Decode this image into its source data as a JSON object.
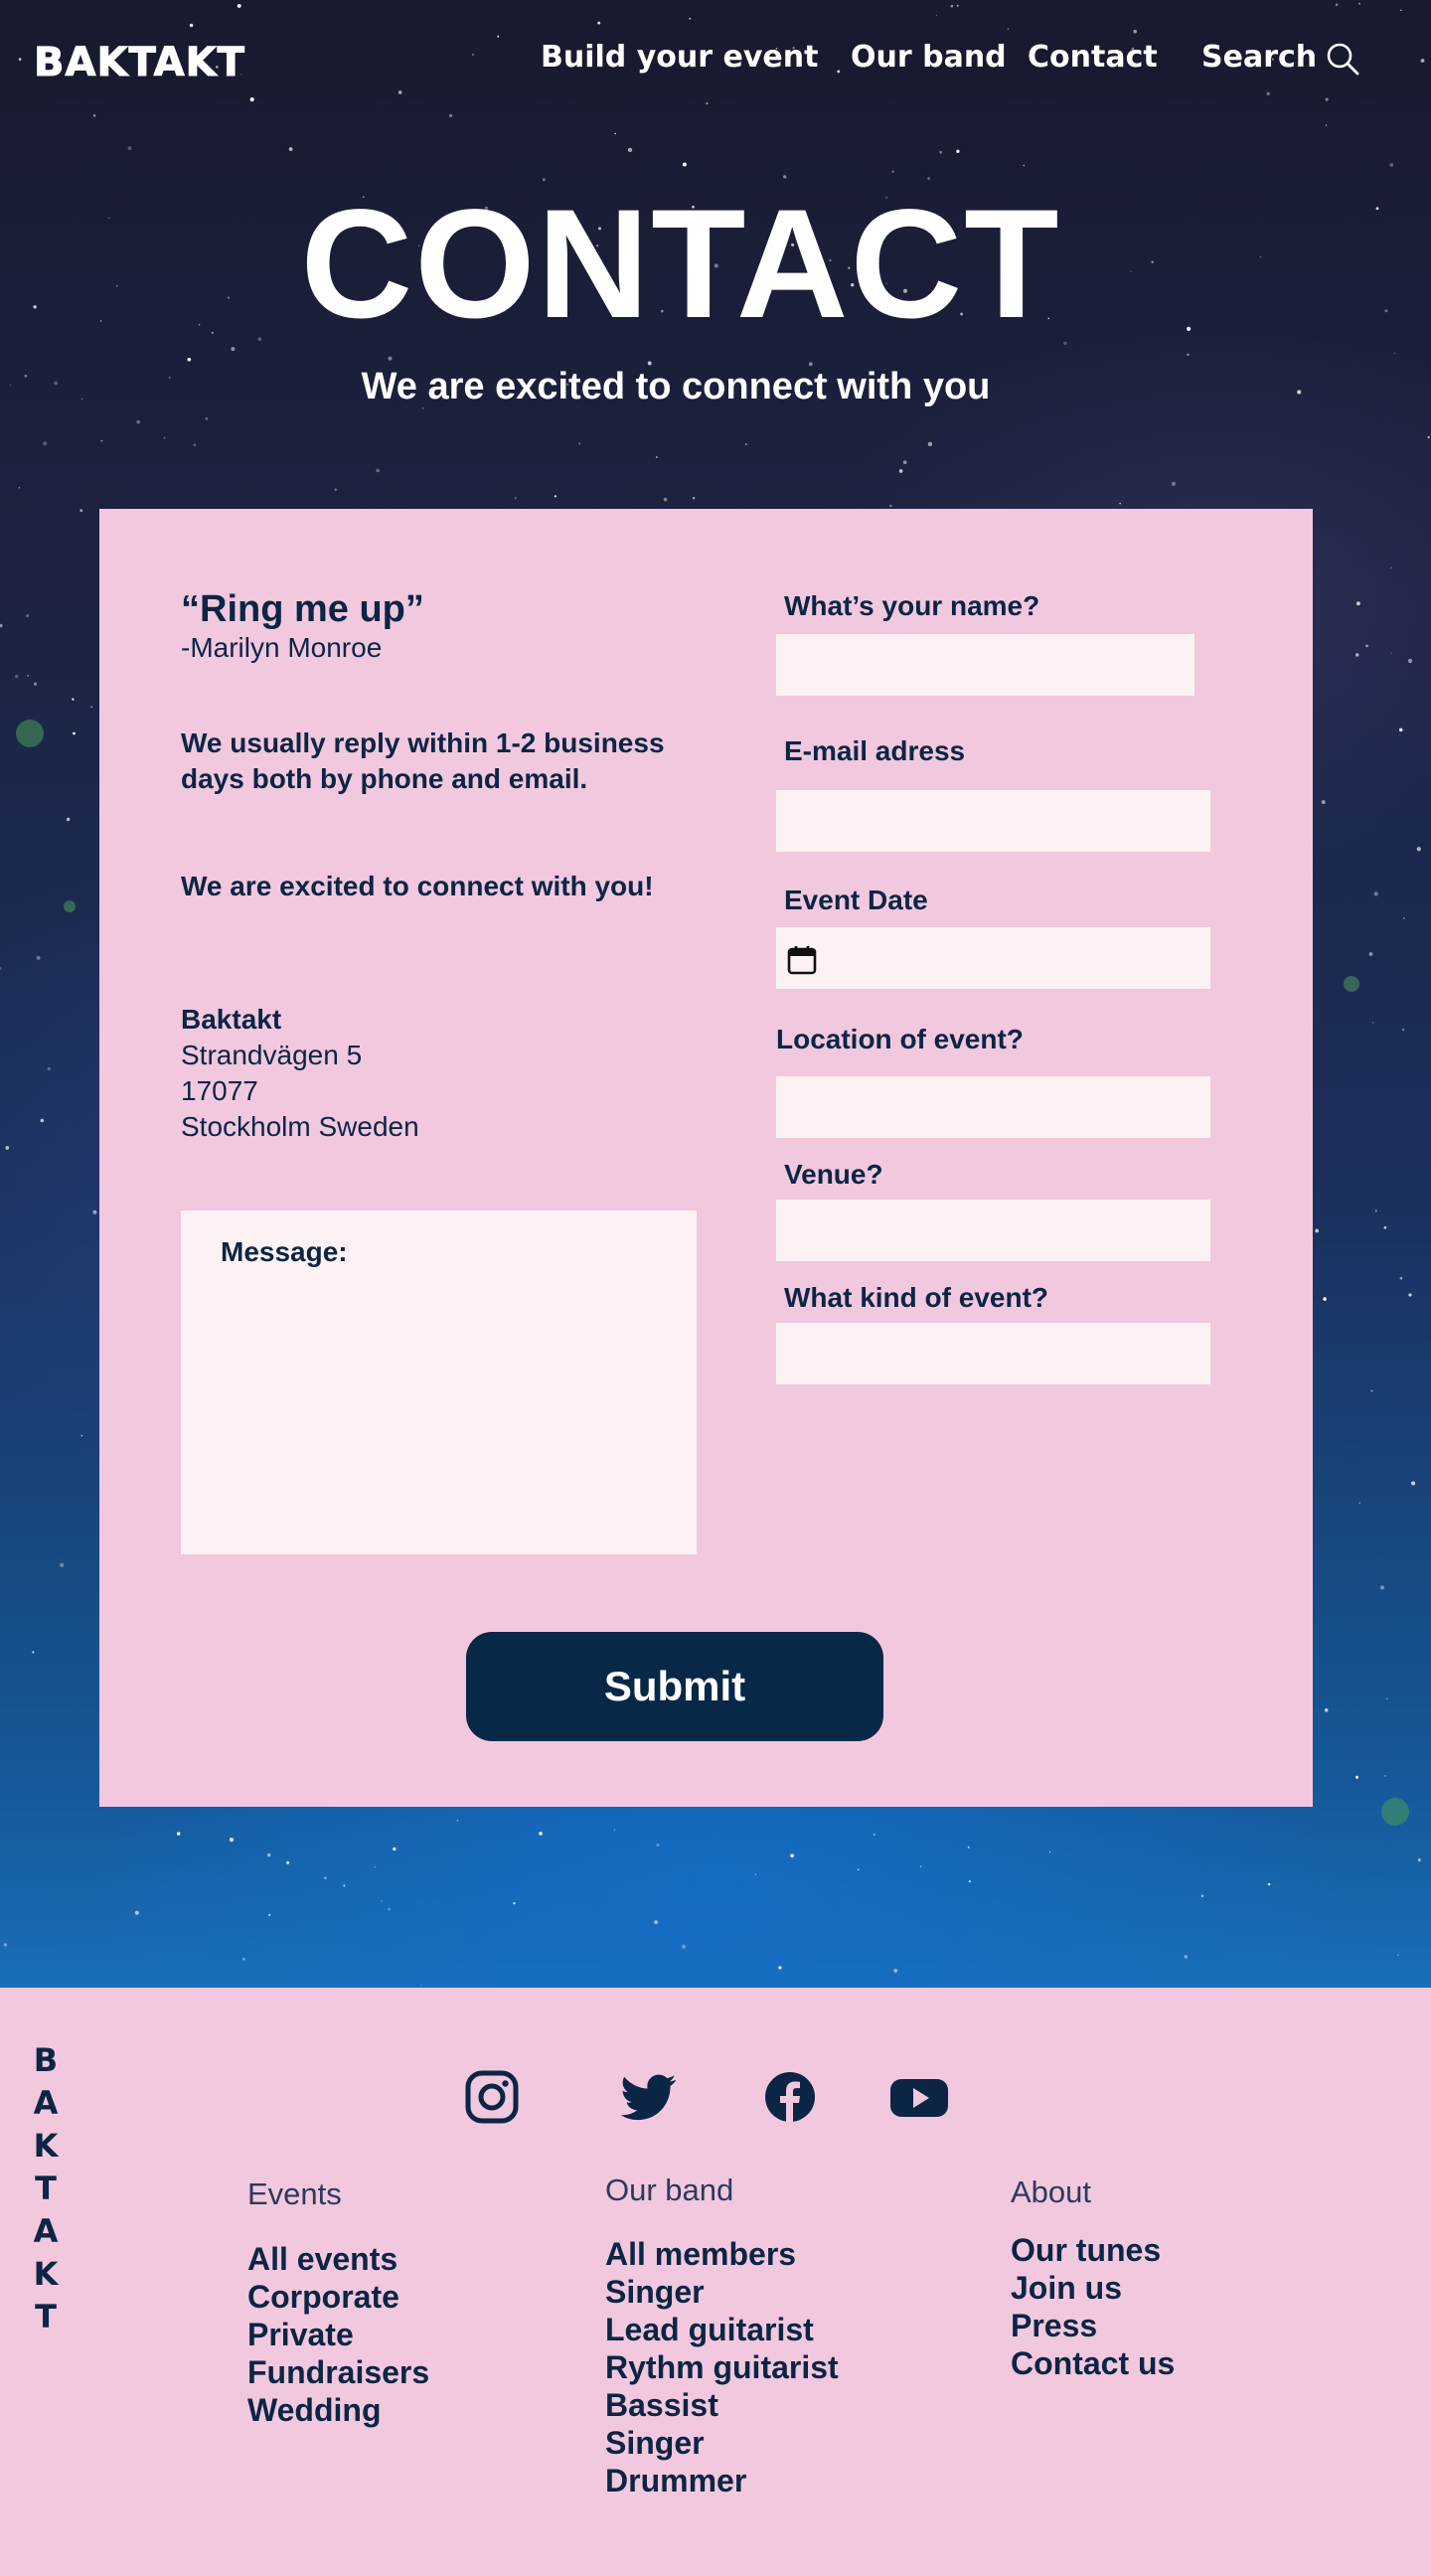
{
  "header": {
    "logo": "BAKTAKT",
    "nav": [
      {
        "label": "Build your event"
      },
      {
        "label": "Our band"
      },
      {
        "label": "Contact"
      },
      {
        "label": "Search"
      }
    ]
  },
  "hero": {
    "title": "CONTACT",
    "subtitle": "We are excited to connect with you"
  },
  "contact": {
    "quote": "“Ring me up”",
    "quote_author": "-Marilyn Monroe",
    "reply_info": "We usually reply within 1-2 business days both by phone and email.",
    "excited_info": "We are excited to connect with you!",
    "address": {
      "name": "Baktakt",
      "street": "Strandvägen 5",
      "zip": "17077",
      "city": "Stockholm Sweden"
    },
    "message_label": "Message:"
  },
  "form": {
    "name_label": "What’s your name?",
    "name_value": "",
    "email_label": "E-mail adress",
    "email_value": "",
    "date_label": "Event Date",
    "date_value": "",
    "location_label": "Location of event?",
    "location_value": "",
    "venue_label": "Venue?",
    "venue_value": "",
    "kind_label": "What kind of event?",
    "kind_value": "",
    "submit_label": "Submit"
  },
  "footer": {
    "logo_letters": [
      "B",
      "A",
      "K",
      "T",
      "A",
      "K",
      "T"
    ],
    "social_icons": [
      "instagram-icon",
      "twitter-icon",
      "facebook-icon",
      "youtube-icon"
    ],
    "columns": [
      {
        "title": "Events",
        "links": [
          "All events",
          "Corporate",
          "Private",
          "Fundraisers",
          "Wedding"
        ]
      },
      {
        "title": "Our band",
        "links": [
          "All members",
          "Singer",
          "Lead guitarist",
          "Rythm guitarist",
          "Bassist",
          "Singer",
          "Drummer"
        ]
      },
      {
        "title": "About",
        "links": [
          "Our tunes",
          "Join us",
          "Press",
          "Contact us"
        ]
      }
    ]
  },
  "colors": {
    "pink": "#f1c8dd",
    "field": "#fcf2f4",
    "navy": "#082848",
    "space_top": "#181a2e",
    "space_bottom": "#1a6fb8"
  }
}
